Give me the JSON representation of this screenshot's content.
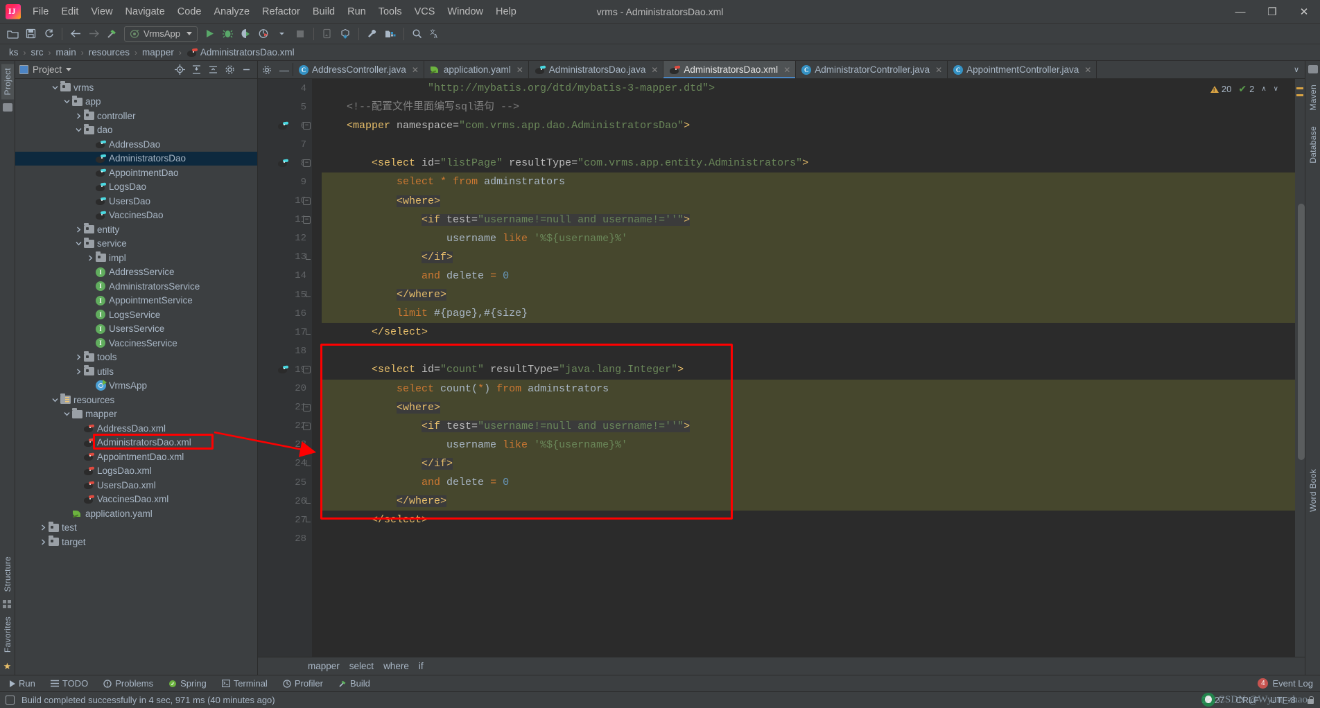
{
  "window": {
    "title": "vrms - AdministratorsDao.xml",
    "minimize": "—",
    "maximize": "❐",
    "close": "✕"
  },
  "menu": [
    {
      "label": "File"
    },
    {
      "label": "Edit"
    },
    {
      "label": "View"
    },
    {
      "label": "Navigate"
    },
    {
      "label": "Code"
    },
    {
      "label": "Analyze"
    },
    {
      "label": "Refactor"
    },
    {
      "label": "Build"
    },
    {
      "label": "Run"
    },
    {
      "label": "Tools"
    },
    {
      "label": "VCS"
    },
    {
      "label": "Window"
    },
    {
      "label": "Help"
    }
  ],
  "toolbar": {
    "run_config": "VrmsApp",
    "icons": [
      "open-folder-icon",
      "save-all-icon",
      "sync-icon",
      "back-icon",
      "forward-icon",
      "build-hammer-icon",
      "run-icon",
      "debug-icon",
      "run-coverage-icon",
      "profile-icon",
      "stop-icon",
      "device-manager-icon",
      "sync-gradle-icon",
      "settings-wrench-icon",
      "project-structure-icon",
      "search-everywhere-icon",
      "translate-icon"
    ]
  },
  "breadcrumb": {
    "items": [
      "ks",
      "src",
      "main",
      "resources",
      "mapper",
      "AdministratorsDao.xml"
    ],
    "separator": "›"
  },
  "project_panel": {
    "title": "Project",
    "actions": [
      "locate-icon",
      "expand-all-icon",
      "collapse-all-icon",
      "settings-gear-icon",
      "hide-icon"
    ],
    "tree": [
      {
        "label": "vrms",
        "indent": 3,
        "icon": "folder",
        "arrow": "down",
        "selected": false
      },
      {
        "label": "app",
        "indent": 4,
        "icon": "folder",
        "arrow": "down",
        "selected": false
      },
      {
        "label": "controller",
        "indent": 5,
        "icon": "folder",
        "arrow": "right",
        "selected": false
      },
      {
        "label": "dao",
        "indent": 5,
        "icon": "folder",
        "arrow": "down",
        "selected": false
      },
      {
        "label": "AddressDao",
        "indent": 6,
        "icon": "bird-cyan",
        "arrow": "",
        "selected": false
      },
      {
        "label": "AdministratorsDao",
        "indent": 6,
        "icon": "bird-cyan",
        "arrow": "",
        "selected": true
      },
      {
        "label": "AppointmentDao",
        "indent": 6,
        "icon": "bird-cyan",
        "arrow": "",
        "selected": false
      },
      {
        "label": "LogsDao",
        "indent": 6,
        "icon": "bird-cyan",
        "arrow": "",
        "selected": false
      },
      {
        "label": "UsersDao",
        "indent": 6,
        "icon": "bird-cyan",
        "arrow": "",
        "selected": false
      },
      {
        "label": "VaccinesDao",
        "indent": 6,
        "icon": "bird-cyan",
        "arrow": "",
        "selected": false
      },
      {
        "label": "entity",
        "indent": 5,
        "icon": "folder",
        "arrow": "right",
        "selected": false
      },
      {
        "label": "service",
        "indent": 5,
        "icon": "folder",
        "arrow": "down",
        "selected": false
      },
      {
        "label": "impl",
        "indent": 6,
        "icon": "folder",
        "arrow": "right",
        "selected": false
      },
      {
        "label": "AddressService",
        "indent": 6,
        "icon": "interface",
        "arrow": "",
        "selected": false
      },
      {
        "label": "AdministratorsService",
        "indent": 6,
        "icon": "interface",
        "arrow": "",
        "selected": false
      },
      {
        "label": "AppointmentService",
        "indent": 6,
        "icon": "interface",
        "arrow": "",
        "selected": false
      },
      {
        "label": "LogsService",
        "indent": 6,
        "icon": "interface",
        "arrow": "",
        "selected": false
      },
      {
        "label": "UsersService",
        "indent": 6,
        "icon": "interface",
        "arrow": "",
        "selected": false
      },
      {
        "label": "VaccinesService",
        "indent": 6,
        "icon": "interface",
        "arrow": "",
        "selected": false
      },
      {
        "label": "tools",
        "indent": 5,
        "icon": "folder",
        "arrow": "right",
        "selected": false
      },
      {
        "label": "utils",
        "indent": 5,
        "icon": "folder",
        "arrow": "right",
        "selected": false
      },
      {
        "label": "VrmsApp",
        "indent": 6,
        "icon": "spring",
        "arrow": "",
        "selected": false
      },
      {
        "label": "resources",
        "indent": 3,
        "icon": "folder-res",
        "arrow": "down",
        "selected": false
      },
      {
        "label": "mapper",
        "indent": 4,
        "icon": "folder-plain",
        "arrow": "down",
        "selected": false
      },
      {
        "label": "AddressDao.xml",
        "indent": 5,
        "icon": "bird-red",
        "arrow": "",
        "selected": false
      },
      {
        "label": "AdministratorsDao.xml",
        "indent": 5,
        "icon": "bird-red",
        "arrow": "",
        "selected": false,
        "annotated": true
      },
      {
        "label": "AppointmentDao.xml",
        "indent": 5,
        "icon": "bird-red",
        "arrow": "",
        "selected": false
      },
      {
        "label": "LogsDao.xml",
        "indent": 5,
        "icon": "bird-red",
        "arrow": "",
        "selected": false
      },
      {
        "label": "UsersDao.xml",
        "indent": 5,
        "icon": "bird-red",
        "arrow": "",
        "selected": false
      },
      {
        "label": "VaccinesDao.xml",
        "indent": 5,
        "icon": "bird-red",
        "arrow": "",
        "selected": false
      },
      {
        "label": "application.yaml",
        "indent": 4,
        "icon": "yaml",
        "arrow": "",
        "selected": false
      },
      {
        "label": "test",
        "indent": 2,
        "icon": "folder",
        "arrow": "right",
        "selected": false
      },
      {
        "label": "target",
        "indent": 2,
        "icon": "folder",
        "arrow": "right",
        "selected": false
      }
    ]
  },
  "left_rail": {
    "tabs": [
      "Project",
      "Structure",
      "Favorites"
    ]
  },
  "right_rail": {
    "tabs": [
      "Maven",
      "Database",
      "Word Book"
    ]
  },
  "editor": {
    "tabs": [
      {
        "label": "AddressController.java",
        "icon": "class",
        "active": false
      },
      {
        "label": "application.yaml",
        "icon": "yaml",
        "active": false
      },
      {
        "label": "AdministratorsDao.java",
        "icon": "bird-cyan",
        "active": false
      },
      {
        "label": "AdministratorsDao.xml",
        "icon": "bird-red",
        "active": true
      },
      {
        "label": "AdministratorController.java",
        "icon": "class",
        "active": false
      },
      {
        "label": "AppointmentController.java",
        "icon": "class",
        "active": false
      }
    ],
    "tab_close": "✕",
    "tab_overflow": "∨",
    "inspections": {
      "warnings": "20",
      "ok": "2",
      "up": "∧",
      "down": "∨"
    },
    "crumbs": [
      "mapper",
      "select",
      "where",
      "if"
    ],
    "first_line_number": 4,
    "lines": [
      {
        "n": 4,
        "highlight": false,
        "fold": "",
        "marker": "",
        "tokens": [
          {
            "t": "                 ",
            "c": "t-txt"
          },
          {
            "t": "\"http://mybatis.org/dtd/mybatis-3-mapper.dtd\">",
            "c": "t-str"
          }
        ]
      },
      {
        "n": 5,
        "highlight": false,
        "fold": "",
        "marker": "",
        "tokens": [
          {
            "t": "    ",
            "c": "t-txt"
          },
          {
            "t": "<!--配置文件里面编写sql语句 -->",
            "c": "t-com"
          }
        ]
      },
      {
        "n": 6,
        "highlight": false,
        "fold": "minus",
        "marker": "bird-cyan",
        "tokens": [
          {
            "t": "    ",
            "c": "t-txt"
          },
          {
            "t": "<mapper ",
            "c": "t-tag"
          },
          {
            "t": "namespace=",
            "c": "t-attr"
          },
          {
            "t": "\"com.vrms.app.dao.AdministratorsDao\"",
            "c": "t-str"
          },
          {
            "t": ">",
            "c": "t-tag"
          }
        ]
      },
      {
        "n": 7,
        "highlight": false,
        "fold": "",
        "marker": "",
        "tokens": []
      },
      {
        "n": 8,
        "highlight": false,
        "fold": "minus",
        "marker": "bird-cyan",
        "tokens": [
          {
            "t": "        ",
            "c": "t-txt"
          },
          {
            "t": "<select ",
            "c": "t-tag"
          },
          {
            "t": "id=",
            "c": "t-attr"
          },
          {
            "t": "\"listPage\" ",
            "c": "t-str"
          },
          {
            "t": "resultType=",
            "c": "t-attr"
          },
          {
            "t": "\"com.vrms.app.entity.Administrators\"",
            "c": "t-str"
          },
          {
            "t": ">",
            "c": "t-tag"
          }
        ]
      },
      {
        "n": 9,
        "highlight": true,
        "fold": "",
        "marker": "",
        "tokens": [
          {
            "t": "            ",
            "c": "t-txt"
          },
          {
            "t": "select ",
            "c": "t-kw"
          },
          {
            "t": "* ",
            "c": "t-kw"
          },
          {
            "t": "from ",
            "c": "t-kw"
          },
          {
            "t": "adminstrators",
            "c": "t-txt"
          }
        ]
      },
      {
        "n": 10,
        "highlight": true,
        "fold": "minus",
        "marker": "",
        "tokens": [
          {
            "t": "            ",
            "c": "t-txt"
          },
          {
            "t": "<where>",
            "c": "t-tag tagbg"
          }
        ]
      },
      {
        "n": 11,
        "highlight": true,
        "fold": "minus",
        "marker": "",
        "tokens": [
          {
            "t": "                ",
            "c": "t-txt"
          },
          {
            "t": "<if ",
            "c": "t-tag tagbg"
          },
          {
            "t": "test=",
            "c": "t-attr tagbg"
          },
          {
            "t": "\"username!=null and username!=''\"",
            "c": "t-str tagbg"
          },
          {
            "t": ">",
            "c": "t-tag tagbg"
          }
        ]
      },
      {
        "n": 12,
        "highlight": true,
        "fold": "",
        "marker": "",
        "tokens": [
          {
            "t": "                    ",
            "c": "t-txt"
          },
          {
            "t": "username ",
            "c": "t-txt"
          },
          {
            "t": "like ",
            "c": "t-kw"
          },
          {
            "t": "'%${username}%'",
            "c": "t-str"
          }
        ]
      },
      {
        "n": 13,
        "highlight": true,
        "fold": "end",
        "marker": "",
        "tokens": [
          {
            "t": "                ",
            "c": "t-txt"
          },
          {
            "t": "</if>",
            "c": "t-tag tagbg"
          }
        ]
      },
      {
        "n": 14,
        "highlight": true,
        "fold": "",
        "marker": "",
        "tokens": [
          {
            "t": "                ",
            "c": "t-txt"
          },
          {
            "t": "and ",
            "c": "t-kw"
          },
          {
            "t": "delete ",
            "c": "t-txt"
          },
          {
            "t": "= ",
            "c": "t-kw"
          },
          {
            "t": "0",
            "c": "t-num"
          }
        ]
      },
      {
        "n": 15,
        "highlight": true,
        "fold": "end",
        "marker": "",
        "tokens": [
          {
            "t": "            ",
            "c": "t-txt"
          },
          {
            "t": "</where>",
            "c": "t-tag tagbg"
          }
        ]
      },
      {
        "n": 16,
        "highlight": true,
        "fold": "",
        "marker": "",
        "tokens": [
          {
            "t": "            ",
            "c": "t-txt"
          },
          {
            "t": "limit ",
            "c": "t-kw"
          },
          {
            "t": "#{page},#{size}",
            "c": "t-txt"
          }
        ]
      },
      {
        "n": 17,
        "highlight": false,
        "fold": "end",
        "marker": "",
        "tokens": [
          {
            "t": "        ",
            "c": "t-txt"
          },
          {
            "t": "</select>",
            "c": "t-tag"
          }
        ]
      },
      {
        "n": 18,
        "highlight": false,
        "fold": "",
        "marker": "",
        "tokens": []
      },
      {
        "n": 19,
        "highlight": false,
        "fold": "minus",
        "marker": "bird-cyan",
        "tokens": [
          {
            "t": "        ",
            "c": "t-txt"
          },
          {
            "t": "<select ",
            "c": "t-tag"
          },
          {
            "t": "id=",
            "c": "t-attr"
          },
          {
            "t": "\"count\" ",
            "c": "t-str"
          },
          {
            "t": "resultType=",
            "c": "t-attr"
          },
          {
            "t": "\"java.lang.Integer\"",
            "c": "t-str"
          },
          {
            "t": ">",
            "c": "t-tag"
          }
        ]
      },
      {
        "n": 20,
        "highlight": true,
        "fold": "",
        "marker": "",
        "tokens": [
          {
            "t": "            ",
            "c": "t-txt"
          },
          {
            "t": "select ",
            "c": "t-kw"
          },
          {
            "t": "count",
            "c": "t-txt"
          },
          {
            "t": "(",
            "c": "t-txt"
          },
          {
            "t": "*",
            "c": "t-kw"
          },
          {
            "t": ") ",
            "c": "t-txt"
          },
          {
            "t": "from ",
            "c": "t-kw"
          },
          {
            "t": "adminstrators",
            "c": "t-txt"
          }
        ]
      },
      {
        "n": 21,
        "highlight": true,
        "fold": "minus",
        "marker": "",
        "tokens": [
          {
            "t": "            ",
            "c": "t-txt"
          },
          {
            "t": "<where>",
            "c": "t-tag tagbg"
          }
        ]
      },
      {
        "n": 22,
        "highlight": true,
        "fold": "minus",
        "marker": "",
        "tokens": [
          {
            "t": "                ",
            "c": "t-txt"
          },
          {
            "t": "<if ",
            "c": "t-tag tagbg"
          },
          {
            "t": "test=",
            "c": "t-attr tagbg"
          },
          {
            "t": "\"username!=null and username!=''\"",
            "c": "t-str tagbg"
          },
          {
            "t": ">",
            "c": "t-tag tagbg"
          }
        ]
      },
      {
        "n": 23,
        "highlight": true,
        "fold": "",
        "marker": "",
        "tokens": [
          {
            "t": "                    ",
            "c": "t-txt"
          },
          {
            "t": "username ",
            "c": "t-txt"
          },
          {
            "t": "like ",
            "c": "t-kw"
          },
          {
            "t": "'%${username}%'",
            "c": "t-str"
          }
        ]
      },
      {
        "n": 24,
        "highlight": true,
        "fold": "end",
        "marker": "",
        "tokens": [
          {
            "t": "                ",
            "c": "t-txt"
          },
          {
            "t": "</if>",
            "c": "t-tag tagbg"
          }
        ]
      },
      {
        "n": 25,
        "highlight": true,
        "fold": "",
        "marker": "",
        "tokens": [
          {
            "t": "                ",
            "c": "t-txt"
          },
          {
            "t": "and ",
            "c": "t-kw"
          },
          {
            "t": "delete ",
            "c": "t-txt"
          },
          {
            "t": "= ",
            "c": "t-kw"
          },
          {
            "t": "0",
            "c": "t-num"
          }
        ]
      },
      {
        "n": 26,
        "highlight": true,
        "fold": "end",
        "marker": "",
        "tokens": [
          {
            "t": "            ",
            "c": "t-txt"
          },
          {
            "t": "</where>",
            "c": "t-tag tagbg"
          }
        ]
      },
      {
        "n": 27,
        "highlight": false,
        "fold": "end",
        "marker": "",
        "tokens": [
          {
            "t": "        ",
            "c": "t-txt"
          },
          {
            "t": "</select>",
            "c": "t-tag"
          }
        ]
      },
      {
        "n": 28,
        "highlight": false,
        "fold": "",
        "marker": "",
        "tokens": []
      }
    ]
  },
  "bottom_bar": {
    "items": [
      {
        "label": "Run",
        "icon": "run-icon"
      },
      {
        "label": "TODO",
        "icon": "todo-icon"
      },
      {
        "label": "Problems",
        "icon": "problems-icon"
      },
      {
        "label": "Spring",
        "icon": "spring-icon"
      },
      {
        "label": "Terminal",
        "icon": "terminal-icon"
      },
      {
        "label": "Profiler",
        "icon": "profiler-icon"
      },
      {
        "label": "Build",
        "icon": "build-icon"
      }
    ],
    "event_log": {
      "label": "Event Log",
      "badge": "4"
    }
  },
  "status_bar": {
    "message": "Build completed successfully in 4 sec, 971 ms (40 minutes ago)",
    "time": "22:27",
    "line_sep": "CRLF",
    "encoding": "UTF-8",
    "indent": "4 spaces",
    "lock": "lock-icon"
  },
  "watermark": "CSDN @Wyatt_zhao",
  "colors": {
    "ui_bg": "#3c3f41",
    "editor_bg": "#2b2b2b",
    "selection_blue": "#0d293e",
    "sql_block_highlight": "#46472d",
    "annotation_red": "#ff0000",
    "tag_yellow": "#e8bf6a",
    "string_green": "#6a8759",
    "keyword_orange": "#cc7832",
    "number_blue": "#6897bb",
    "text_gray": "#a9b7c6"
  }
}
